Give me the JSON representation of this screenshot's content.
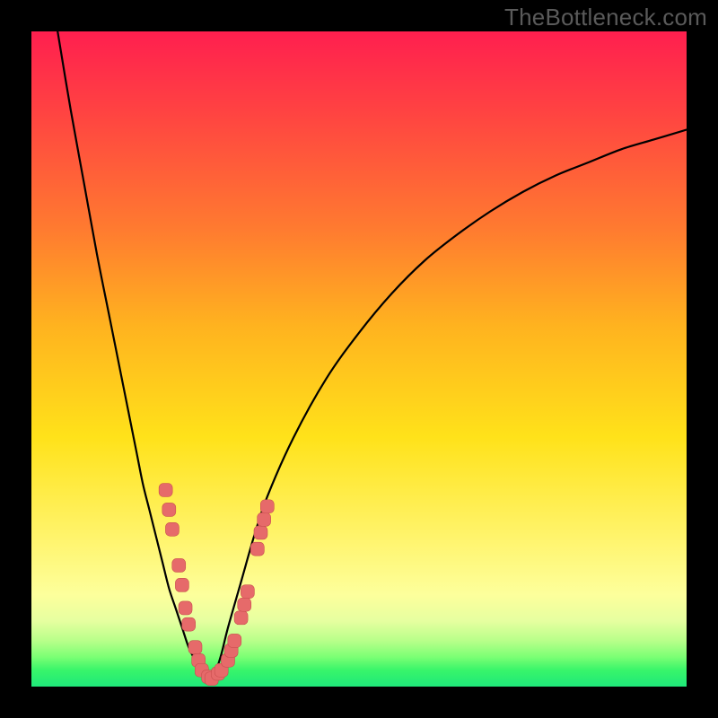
{
  "watermark": "TheBottleneck.com",
  "colors": {
    "frame": "#000000",
    "curve_stroke": "#000000",
    "marker_fill": "#e66a6a",
    "marker_stroke": "#c94f4f",
    "watermark_text": "#5a5a5a"
  },
  "chart_data": {
    "type": "line",
    "title": "",
    "xlabel": "",
    "ylabel": "",
    "xlim": [
      0,
      100
    ],
    "ylim": [
      0,
      100
    ],
    "grid": false,
    "legend": false,
    "annotations": [
      "TheBottleneck.com"
    ],
    "series": [
      {
        "name": "left-branch",
        "x": [
          4,
          6,
          8,
          10,
          12,
          14,
          16,
          17,
          18,
          19,
          20,
          21,
          22,
          23,
          24,
          25,
          26,
          27
        ],
        "y": [
          100,
          88,
          77,
          66,
          56,
          46,
          36,
          31,
          27,
          23,
          19,
          15,
          12,
          9,
          6,
          4,
          2,
          0.5
        ]
      },
      {
        "name": "right-branch",
        "x": [
          27,
          28,
          29,
          30,
          32,
          34,
          36,
          40,
          45,
          50,
          55,
          60,
          65,
          70,
          75,
          80,
          85,
          90,
          95,
          100
        ],
        "y": [
          0.5,
          2,
          5,
          9,
          16,
          23,
          29,
          38,
          47,
          54,
          60,
          65,
          69,
          72.5,
          75.5,
          78,
          80,
          82,
          83.5,
          85
        ]
      }
    ],
    "markers": {
      "name": "highlight-points",
      "shape": "rounded-square",
      "points": [
        {
          "x": 20.5,
          "y": 30.0
        },
        {
          "x": 21.0,
          "y": 27.0
        },
        {
          "x": 21.5,
          "y": 24.0
        },
        {
          "x": 22.5,
          "y": 18.5
        },
        {
          "x": 23.0,
          "y": 15.5
        },
        {
          "x": 23.5,
          "y": 12.0
        },
        {
          "x": 24.0,
          "y": 9.5
        },
        {
          "x": 25.0,
          "y": 6.0
        },
        {
          "x": 25.5,
          "y": 4.0
        },
        {
          "x": 26.0,
          "y": 2.5
        },
        {
          "x": 27.0,
          "y": 1.5
        },
        {
          "x": 27.5,
          "y": 1.2
        },
        {
          "x": 28.5,
          "y": 2.0
        },
        {
          "x": 29.0,
          "y": 2.5
        },
        {
          "x": 30.0,
          "y": 4.0
        },
        {
          "x": 30.5,
          "y": 5.5
        },
        {
          "x": 31.0,
          "y": 7.0
        },
        {
          "x": 32.0,
          "y": 10.5
        },
        {
          "x": 32.5,
          "y": 12.5
        },
        {
          "x": 33.0,
          "y": 14.5
        },
        {
          "x": 34.5,
          "y": 21.0
        },
        {
          "x": 35.0,
          "y": 23.5
        },
        {
          "x": 35.5,
          "y": 25.5
        },
        {
          "x": 36.0,
          "y": 27.5
        }
      ]
    }
  }
}
